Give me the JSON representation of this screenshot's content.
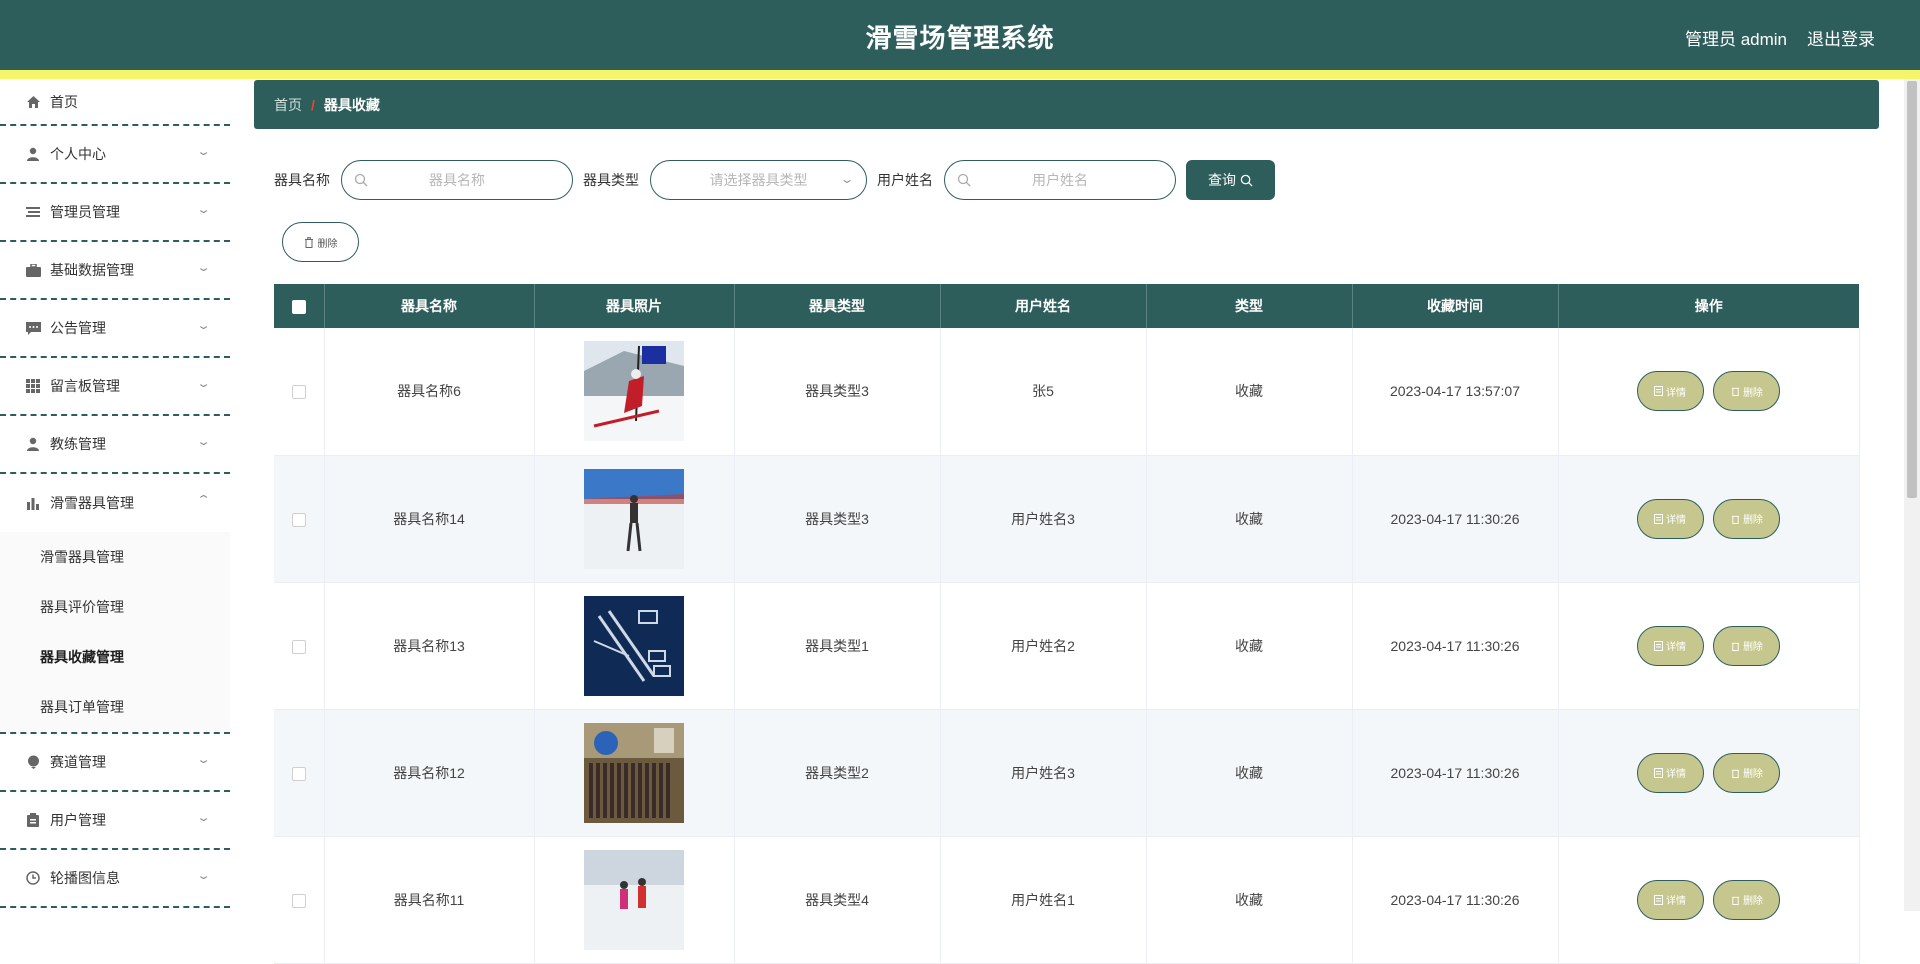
{
  "header": {
    "title": "滑雪场管理系统",
    "user": "管理员 admin",
    "logout": "退出登录"
  },
  "sidebar": {
    "items": [
      {
        "label": "首页",
        "icon": "home-icon"
      },
      {
        "label": "个人中心",
        "icon": "user-icon"
      },
      {
        "label": "管理员管理",
        "icon": "list-icon"
      },
      {
        "label": "基础数据管理",
        "icon": "briefcase-icon"
      },
      {
        "label": "公告管理",
        "icon": "message-icon"
      },
      {
        "label": "留言板管理",
        "icon": "grid-icon"
      },
      {
        "label": "教练管理",
        "icon": "person-icon"
      },
      {
        "label": "滑雪器具管理",
        "icon": "chart-icon"
      },
      {
        "label": "赛道管理",
        "icon": "pin-icon"
      },
      {
        "label": "用户管理",
        "icon": "clipboard-icon"
      },
      {
        "label": "轮播图信息",
        "icon": "clock-icon"
      }
    ],
    "submenu": [
      {
        "label": "滑雪器具管理"
      },
      {
        "label": "器具评价管理"
      },
      {
        "label": "器具收藏管理"
      },
      {
        "label": "器具订单管理"
      }
    ]
  },
  "breadcrumb": {
    "home": "首页",
    "separator": "/",
    "current": "器具收藏"
  },
  "search": {
    "name_label": "器具名称",
    "name_placeholder": "器具名称",
    "type_label": "器具类型",
    "type_placeholder": "请选择器具类型",
    "user_label": "用户姓名",
    "user_placeholder": "用户姓名",
    "query_button": "查询"
  },
  "toolbar": {
    "delete_label": "删除"
  },
  "table": {
    "columns": [
      "器具名称",
      "器具照片",
      "器具类型",
      "用户姓名",
      "类型",
      "收藏时间",
      "操作"
    ],
    "detail_label": "详情",
    "delete_label": "删除",
    "rows": [
      {
        "name": "器具名称6",
        "type": "器具类型3",
        "user": "张5",
        "kind": "收藏",
        "time": "2023-04-17 13:57:07"
      },
      {
        "name": "器具名称14",
        "type": "器具类型3",
        "user": "用户姓名3",
        "kind": "收藏",
        "time": "2023-04-17 11:30:26"
      },
      {
        "name": "器具名称13",
        "type": "器具类型1",
        "user": "用户姓名2",
        "kind": "收藏",
        "time": "2023-04-17 11:30:26"
      },
      {
        "name": "器具名称12",
        "type": "器具类型2",
        "user": "用户姓名3",
        "kind": "收藏",
        "time": "2023-04-17 11:30:26"
      },
      {
        "name": "器具名称11",
        "type": "器具类型4",
        "user": "用户姓名1",
        "kind": "收藏",
        "time": "2023-04-17 11:30:26"
      }
    ]
  },
  "colors": {
    "primary": "#2e5e5c",
    "accent_stripe": "#f5f56a",
    "op_button": "#c6c78e"
  }
}
